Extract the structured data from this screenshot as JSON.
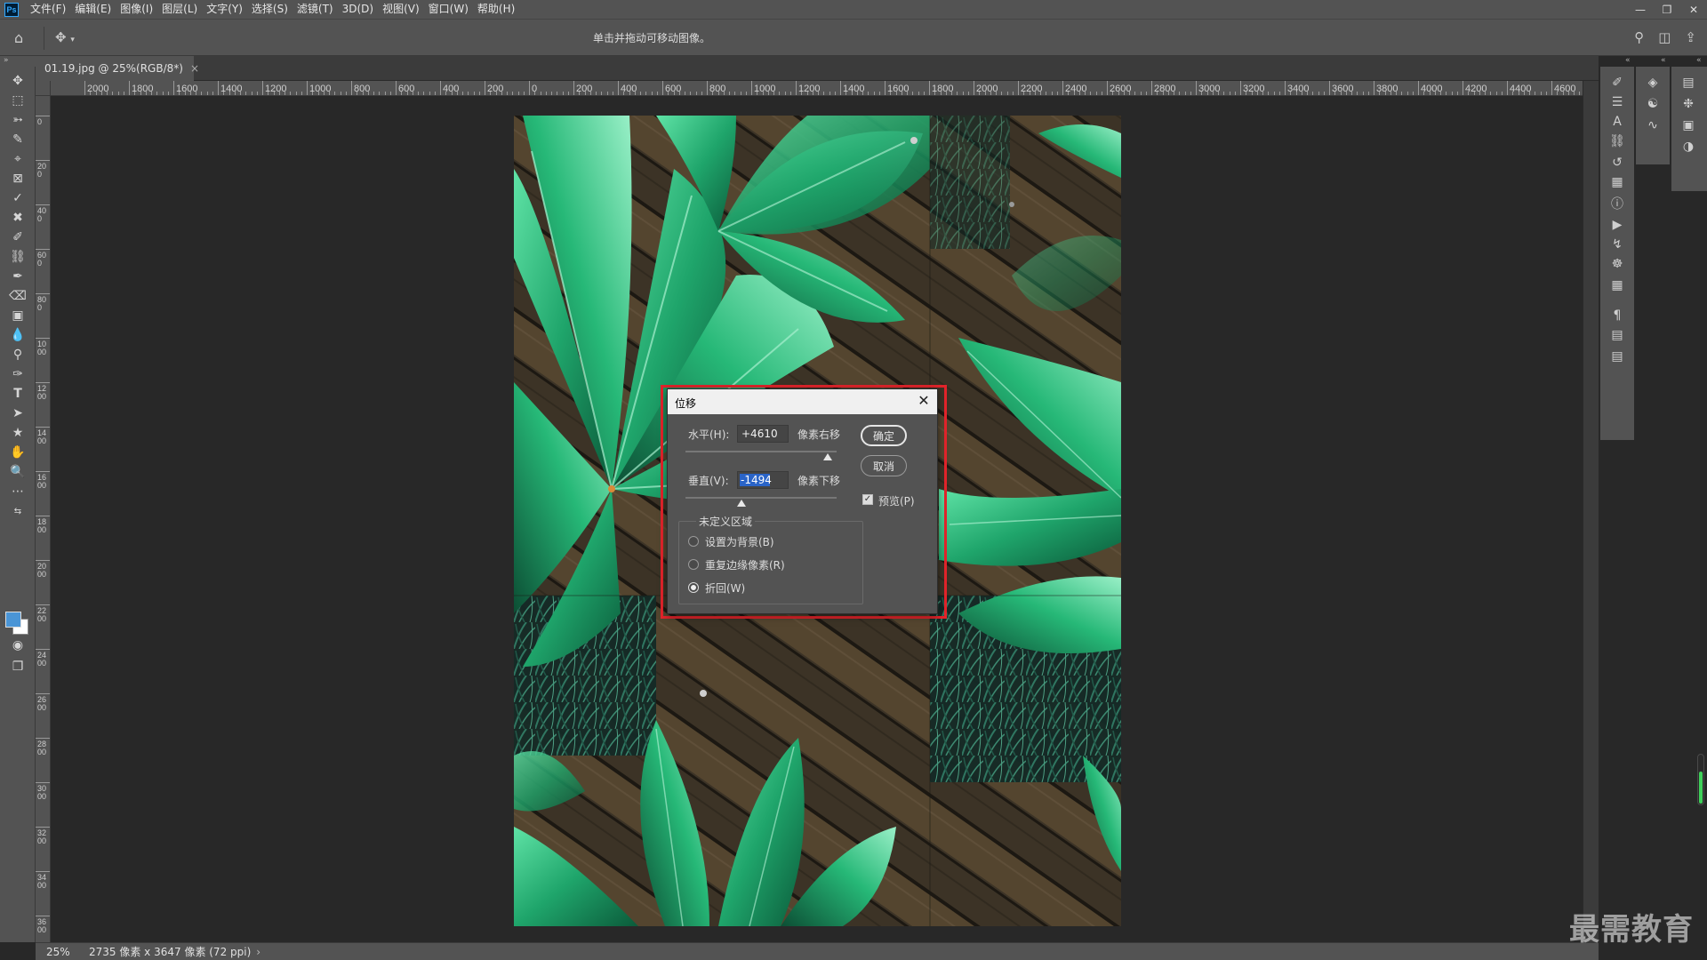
{
  "app": {
    "logo_text": "Ps"
  },
  "menu": [
    "文件(F)",
    "编辑(E)",
    "图像(I)",
    "图层(L)",
    "文字(Y)",
    "选择(S)",
    "滤镜(T)",
    "3D(D)",
    "视图(V)",
    "窗口(W)",
    "帮助(H)"
  ],
  "options_bar": {
    "hint": "单击并拖动可移动图像。"
  },
  "document": {
    "tab_title": "01.19.jpg @ 25%(RGB/8*)"
  },
  "ruler": {
    "h_labels": [
      "2000",
      "1800",
      "1600",
      "1400",
      "1200",
      "1000",
      "800",
      "600",
      "400",
      "200",
      "0",
      "200",
      "400",
      "600",
      "800",
      "1000",
      "1200",
      "1400",
      "1600",
      "1800",
      "2000",
      "2200",
      "2400",
      "2600",
      "2800",
      "3000",
      "3200",
      "3400",
      "3600",
      "3800",
      "4000",
      "4200",
      "4400",
      "4600"
    ],
    "v_labels": [
      "0",
      "200",
      "400",
      "600",
      "800",
      "1000",
      "1200",
      "1400",
      "1600",
      "1800",
      "2000",
      "2200",
      "2400",
      "2600",
      "2800",
      "3000",
      "3200",
      "3400",
      "3600"
    ]
  },
  "dialog": {
    "title": "位移",
    "horizontal_label": "水平(H):",
    "horizontal_value": "+4610",
    "horizontal_unit": "像素右移",
    "vertical_label": "垂直(V):",
    "vertical_value": "-1494",
    "vertical_unit": "像素下移",
    "ok_label": "确定",
    "cancel_label": "取消",
    "preview_label": "预览(P)",
    "preview_checked": true,
    "group_label": "未定义区域",
    "options": [
      {
        "label": "设置为背景(B)",
        "checked": false
      },
      {
        "label": "重复边缘像素(R)",
        "checked": false
      },
      {
        "label": "折回(W)",
        "checked": true
      }
    ]
  },
  "status": {
    "zoom": "25%",
    "info": "2735 像素 x 3647 像素 (72 ppi)"
  },
  "watermark": "最需教育",
  "colors": {
    "foreground": "#4a95d6",
    "background": "#ffffff",
    "highlight": "#e3242b"
  }
}
